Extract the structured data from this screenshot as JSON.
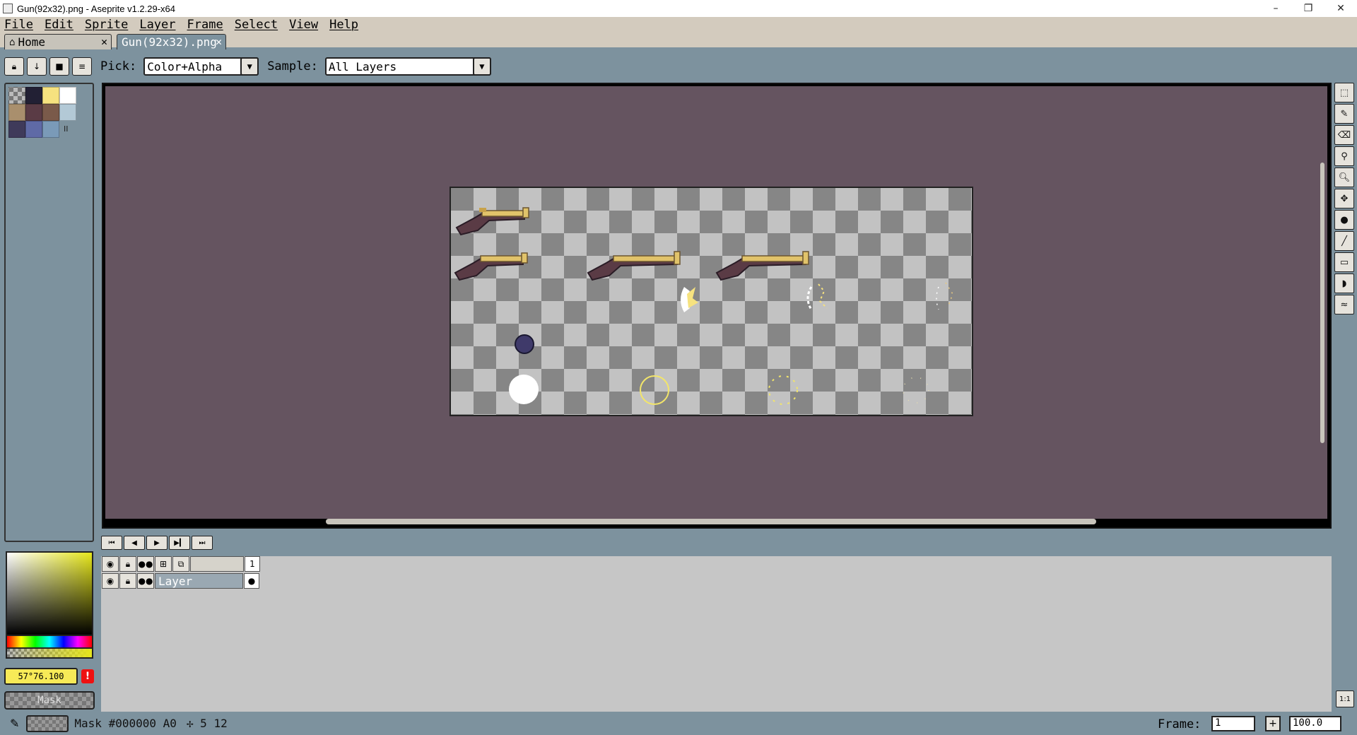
{
  "window": {
    "title": "Gun(92x32).png - Aseprite v1.2.29-x64",
    "minimize": "–",
    "restore": "❐",
    "close": "✕"
  },
  "menu": [
    "File",
    "Edit",
    "Sprite",
    "Layer",
    "Frame",
    "Select",
    "View",
    "Help"
  ],
  "tabs": [
    {
      "label": "Home",
      "close": "✕"
    },
    {
      "label": "Gun(92x32).png",
      "close": "✕"
    }
  ],
  "context_bar": {
    "pick_label": "Pick:",
    "pick_value": "Color+Alpha",
    "sample_label": "Sample:",
    "sample_value": "All Layers"
  },
  "palette": {
    "colors": [
      "checker",
      "#222034",
      "#f6e27f",
      "#ffffff",
      "#a98f6d",
      "#5a3b45",
      "#7a5a4a",
      "#b3c9d6",
      "#3f3a5a",
      "#5f6aa6",
      "#7a9ab8"
    ],
    "more": "II"
  },
  "color_picker": {
    "hex_value": "57°76.100",
    "warning": "!",
    "mask_label": "Mask"
  },
  "timeline": {
    "layer_name": "Layer",
    "frame_number": "1"
  },
  "statusbar": {
    "text": "Mask #000000 A0",
    "position": "✢ 5 12",
    "frame_label": "Frame:",
    "frame_value": "1",
    "add": "+",
    "zoom": "100.0"
  },
  "toolbar_icons": [
    "marquee-icon",
    "pencil-icon",
    "eraser-icon",
    "eyedropper-icon",
    "zoom-icon",
    "move-icon",
    "fill-icon",
    "line-icon",
    "rectangle-icon",
    "contour-icon",
    "blur-icon"
  ],
  "zoom_one_to_one": "1:1"
}
